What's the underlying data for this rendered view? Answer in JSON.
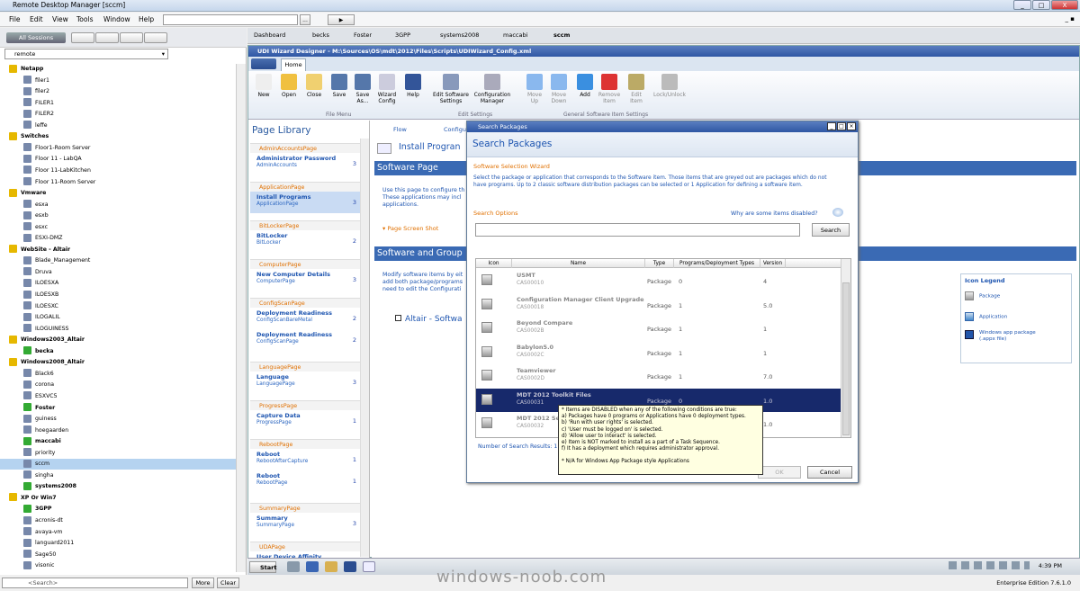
{
  "app": {
    "title": "Remote Desktop Manager [sccm]",
    "window_buttons": [
      "_",
      "□",
      "X"
    ],
    "menu": [
      "File",
      "Edit",
      "View",
      "Tools",
      "Window",
      "Help"
    ],
    "menu_buttons": [
      "...",
      "▶"
    ],
    "mdi_buttons": "_ ▪",
    "edition": "Enterprise Edition 7.6.1.0",
    "watermark": "windows-noob.com"
  },
  "left": {
    "sessions_label": "All Sessions",
    "vault": "remote",
    "search_placeholder": "<Search>",
    "more": "More",
    "clear": "Clear",
    "tree": [
      {
        "label": "Netapp",
        "group": true
      },
      {
        "label": "filer1"
      },
      {
        "label": "filer2"
      },
      {
        "label": "FILER1"
      },
      {
        "label": "FILER2"
      },
      {
        "label": "leffe"
      },
      {
        "label": "Switches",
        "group": true
      },
      {
        "label": "Floor1-Room Server"
      },
      {
        "label": "Floor 11 - LabQA"
      },
      {
        "label": "Floor 11-LabKitchen"
      },
      {
        "label": "Floor 11-Room Server"
      },
      {
        "label": "Vmware",
        "group": true
      },
      {
        "label": "esxa"
      },
      {
        "label": "esxb"
      },
      {
        "label": "esxc"
      },
      {
        "label": "ESXI-DMZ"
      },
      {
        "label": "WebSite - Altair",
        "group": true
      },
      {
        "label": "Blade_Management"
      },
      {
        "label": "Druva"
      },
      {
        "label": "ILOESXA"
      },
      {
        "label": "ILOESXB"
      },
      {
        "label": "ILOESXC"
      },
      {
        "label": "ILOGALIL"
      },
      {
        "label": "ILOGUINESS"
      },
      {
        "label": "Windows2003_Altair",
        "group": true
      },
      {
        "label": "becka",
        "bold": true
      },
      {
        "label": "Windows2008_Altair",
        "group": true
      },
      {
        "label": "Black6"
      },
      {
        "label": "corona"
      },
      {
        "label": "ESXVC5"
      },
      {
        "label": "Foster",
        "bold": true
      },
      {
        "label": "guiness"
      },
      {
        "label": "hoegaarden"
      },
      {
        "label": "maccabi",
        "bold": true
      },
      {
        "label": "priority"
      },
      {
        "label": "sccm",
        "selected": true
      },
      {
        "label": "singha"
      },
      {
        "label": "systems2008",
        "bold": true
      },
      {
        "label": "XP Or Win7",
        "group": true
      },
      {
        "label": "3GPP",
        "bold": true
      },
      {
        "label": "acronis-dt"
      },
      {
        "label": "avaya-vm"
      },
      {
        "label": "languard2011"
      },
      {
        "label": "Sage50"
      },
      {
        "label": "visonic"
      }
    ]
  },
  "tabs": [
    "Dashboard",
    "becks",
    "Foster",
    "3GPP",
    "systems2008",
    "maccabi",
    "sccm"
  ],
  "inner": {
    "title": "UDI Wizard Designer - M:\\Sources\\OS\\mdt\\2012\\Files\\Scripts\\UDIWizard_Config.xml",
    "ribbon_tab": "Home",
    "ribbon_buttons": [
      {
        "label": "New"
      },
      {
        "label": "Open"
      },
      {
        "label": "Close"
      },
      {
        "label": "Save"
      },
      {
        "label": "Save\nAs..."
      },
      {
        "label": "Wizard\nConfig"
      },
      {
        "label": "Help"
      },
      {
        "label": "Edit Software\nSettings"
      },
      {
        "label": "Configuration\nManager"
      },
      {
        "label": "Move\nUp"
      },
      {
        "label": "Move\nDown"
      },
      {
        "label": "Add"
      },
      {
        "label": "Remove\nItem"
      },
      {
        "label": "Edit\nItem"
      },
      {
        "label": "Lock/Unlock"
      }
    ],
    "ribbon_groups": [
      "File Menu",
      "Edit Settings",
      "General Software Item Settings"
    ],
    "page_library_title": "Page Library",
    "page_groups": [
      {
        "header": "AdminAccountsPage",
        "name": "Administrator Password",
        "sub": "AdminAccounts",
        "count": "3"
      },
      {
        "header": "ApplicationPage",
        "name": "Install Programs",
        "sub": "ApplicationPage",
        "count": "3",
        "selected": true
      },
      {
        "header": "BitLockerPage",
        "name": "BitLocker",
        "sub": "BitLocker",
        "count": "2"
      },
      {
        "header": "ComputerPage",
        "name": "New Computer Details",
        "sub": "ComputerPage",
        "count": "3"
      },
      {
        "header": "ConfigScanPage",
        "name": "Deployment Readiness",
        "sub": "ConfigScanBareMetal",
        "count": "2",
        "name2": "Deployment Readiness",
        "sub2": "ConfigScanPage",
        "count2": "2"
      },
      {
        "header": "LanguagePage",
        "name": "Language",
        "sub": "LanguagePage",
        "count": "3"
      },
      {
        "header": "ProgressPage",
        "name": "Capture Data",
        "sub": "ProgressPage",
        "count": "1"
      },
      {
        "header": "RebootPage",
        "name": "Reboot",
        "sub": "RebootAfterCapture",
        "count": "1",
        "name2": "Reboot",
        "sub2": "RebootPage",
        "count2": "1"
      },
      {
        "header": "SummaryPage",
        "name": "Summary",
        "sub": "SummaryPage",
        "count": "3"
      },
      {
        "header": "UDAPage",
        "name": "User Device Affinity",
        "sub": "",
        "count": ""
      }
    ],
    "flow_tab": "Flow",
    "config_tab": "Configu",
    "install_programs": "Install Progran",
    "software_page": "Software Page",
    "sw_text": [
      "Use this page to configure th",
      "These applications may incl",
      "applications."
    ],
    "page_screenshot": "Page Screen Shot",
    "sw_groups": "Software and Group",
    "modify_text": [
      "Modify software items by eit",
      "add both package/programs",
      "need to edit the Configurati"
    ],
    "altair": "Altair - Softwa",
    "icon_legend": {
      "title": "Icon Legend",
      "package": "Package",
      "application": "Application",
      "winapp1": "Windows app package",
      "winapp2": "(.appx file)"
    },
    "start": "Start",
    "clock": "4:39 PM"
  },
  "dialog": {
    "title": "Search Packages",
    "heading": "Search Packages",
    "wizard": "Software Selection Wizard",
    "desc1": "Select the package or application that corresponds to the Software item.  Those items that are greyed out are packages which do not",
    "desc2": "have programs.  Up to 2 classic software distribution packages can be selected or 1 Application for defining a software item.",
    "search_options": "Search Options",
    "why": "Why are some items disabled?",
    "search_btn": "Search",
    "columns": [
      "Icon",
      "Name",
      "Type",
      "Programs/Deployment Types",
      "Version"
    ],
    "rows": [
      {
        "name": "USMT",
        "code": "CAS00010",
        "type": "Package",
        "programs": "0",
        "version": "4"
      },
      {
        "name": "Configuration Manager Client Upgrade",
        "code": "CAS00018",
        "type": "Package",
        "programs": "1",
        "version": "5.0"
      },
      {
        "name": "Beyond Compare",
        "code": "CAS0002B",
        "type": "Package",
        "programs": "1",
        "version": "1"
      },
      {
        "name": "Babylon5.0",
        "code": "CAS0002C",
        "type": "Package",
        "programs": "1",
        "version": "1"
      },
      {
        "name": "Teamviewer",
        "code": "CAS0002D",
        "type": "Package",
        "programs": "1",
        "version": "7.0"
      },
      {
        "name": "MDT 2012 Toolkit Files",
        "code": "CAS00031",
        "type": "Package",
        "programs": "0",
        "version": "1.0",
        "selected": true
      },
      {
        "name": "MDT 2012 Setti",
        "code": "CAS00032",
        "type": "",
        "programs": "",
        "version": "1.0"
      }
    ],
    "num_results": "Number of Search Results: 1",
    "ok": "OK",
    "cancel": "Cancel",
    "tooltip": [
      "* Items are DISABLED when any of the following conditions are true:",
      "a)  Packages have 0 programs or Applications have 0 deployment types.",
      "b)  'Run with user rights' is selected.",
      "c)  'User must be logged on' is selected.",
      "d)  'Allow user to interact' is selected.",
      "e)  Item is NOT marked to install as a part of a Task Sequence.",
      "f)  It has a deployment which requires administrator approval.",
      "",
      "* N/A for Windows App Package style Applications"
    ]
  },
  "colors": {
    "accent": "#3a6ab4",
    "orange": "#e07000",
    "link": "#1e55b0",
    "selection": "#17296b"
  }
}
